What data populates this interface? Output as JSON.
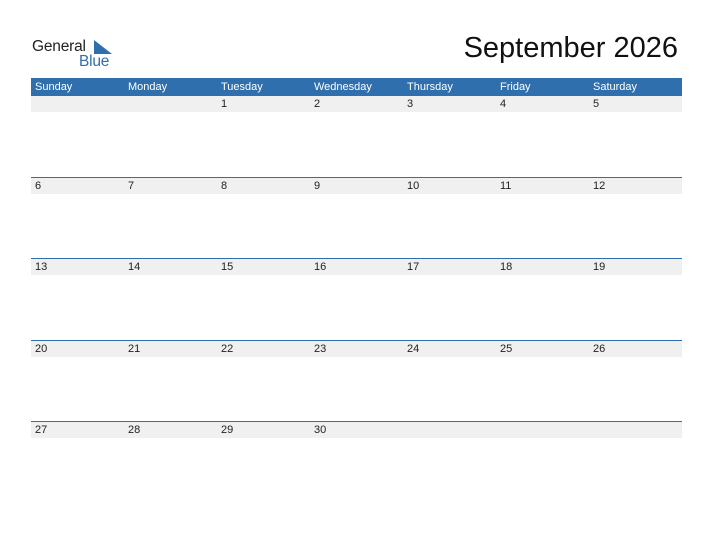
{
  "brand": {
    "line1": "General",
    "line2": "Blue",
    "accent_color": "#2f6fae"
  },
  "title": "September 2026",
  "weekdays": [
    "Sunday",
    "Monday",
    "Tuesday",
    "Wednesday",
    "Thursday",
    "Friday",
    "Saturday"
  ],
  "weeks": [
    [
      "",
      "",
      "1",
      "2",
      "3",
      "4",
      "5"
    ],
    [
      "6",
      "7",
      "8",
      "9",
      "10",
      "11",
      "12"
    ],
    [
      "13",
      "14",
      "15",
      "16",
      "17",
      "18",
      "19"
    ],
    [
      "20",
      "21",
      "22",
      "23",
      "24",
      "25",
      "26"
    ],
    [
      "27",
      "28",
      "29",
      "30",
      "",
      "",
      ""
    ]
  ]
}
